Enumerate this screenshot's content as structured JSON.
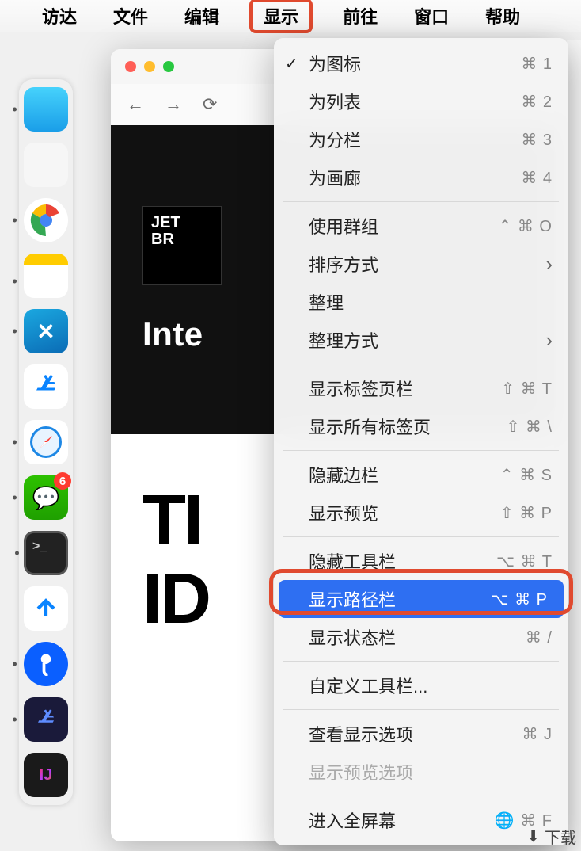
{
  "menubar": {
    "items": [
      "访达",
      "文件",
      "编辑",
      "显示",
      "前往",
      "窗口",
      "帮助"
    ],
    "highlighted_index": 3
  },
  "dock": {
    "wechat_badge": "6",
    "intellij_label": "IJ"
  },
  "finder_window": {
    "logo_text": "JET\nBR",
    "heading": "Inte",
    "big_text_1": "TI",
    "big_text_2": "ID"
  },
  "dropdown": {
    "groups": [
      [
        {
          "label": "为图标",
          "shortcut": "⌘ 1",
          "checked": true
        },
        {
          "label": "为列表",
          "shortcut": "⌘ 2"
        },
        {
          "label": "为分栏",
          "shortcut": "⌘ 3"
        },
        {
          "label": "为画廊",
          "shortcut": "⌘ 4"
        }
      ],
      [
        {
          "label": "使用群组",
          "shortcut": "⌃ ⌘ O"
        },
        {
          "label": "排序方式",
          "submenu": true
        },
        {
          "label": "整理"
        },
        {
          "label": "整理方式",
          "submenu": true
        }
      ],
      [
        {
          "label": "显示标签页栏",
          "shortcut": "⇧ ⌘ T"
        },
        {
          "label": "显示所有标签页",
          "shortcut": "⇧ ⌘ \\"
        }
      ],
      [
        {
          "label": "隐藏边栏",
          "shortcut": "⌃ ⌘ S"
        },
        {
          "label": "显示预览",
          "shortcut": "⇧ ⌘ P"
        }
      ],
      [
        {
          "label": "隐藏工具栏",
          "shortcut": "⌥ ⌘ T"
        },
        {
          "label": "显示路径栏",
          "shortcut": "⌥ ⌘ P",
          "highlighted": true
        },
        {
          "label": "显示状态栏",
          "shortcut": "⌘ /"
        }
      ],
      [
        {
          "label": "自定义工具栏..."
        }
      ],
      [
        {
          "label": "查看显示选项",
          "shortcut": "⌘ J"
        },
        {
          "label": "显示预览选项",
          "disabled": true
        }
      ],
      [
        {
          "label": "进入全屏幕",
          "shortcut": "🌐 ⌘ F"
        }
      ]
    ]
  },
  "bottom_label": "下载"
}
